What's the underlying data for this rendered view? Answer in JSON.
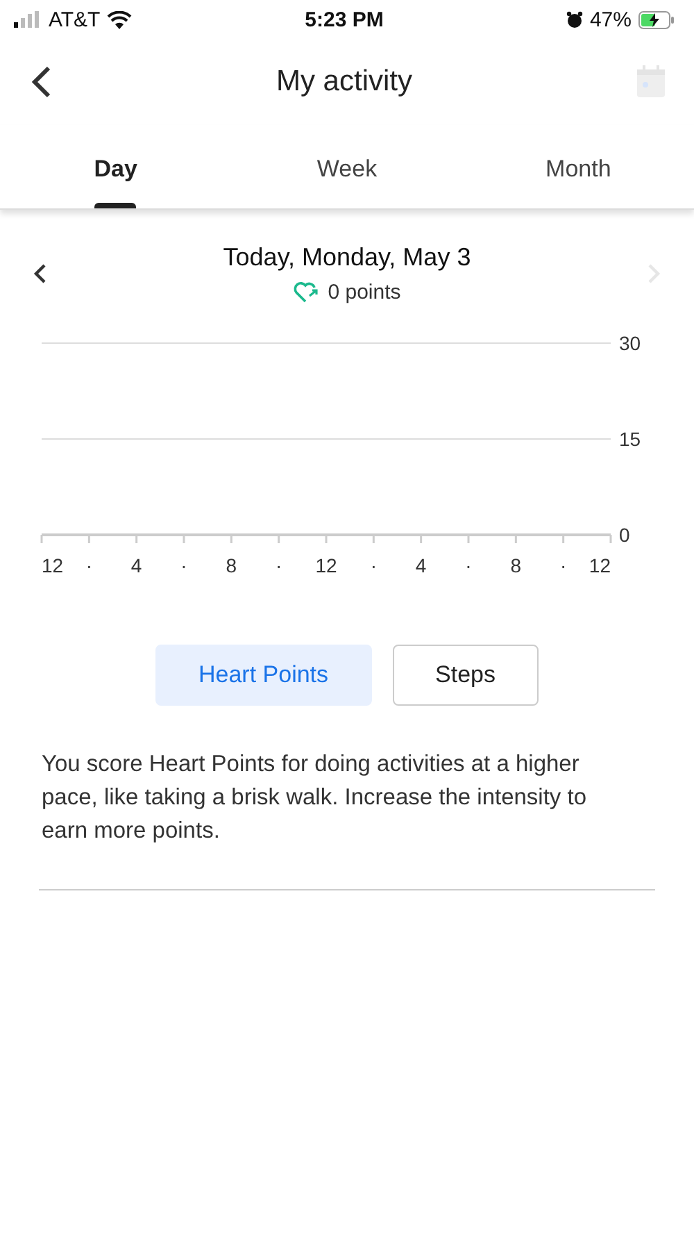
{
  "status_bar": {
    "carrier": "AT&T",
    "time": "5:23 PM",
    "battery": "47%"
  },
  "header": {
    "title": "My activity"
  },
  "tabs": [
    {
      "label": "Day",
      "selected": true
    },
    {
      "label": "Week",
      "selected": false
    },
    {
      "label": "Month",
      "selected": false
    }
  ],
  "day": {
    "title": "Today, Monday, May 3",
    "points": "0 points",
    "next_disabled": true
  },
  "chart": {
    "chart_data": {
      "type": "bar",
      "ylim": [
        0,
        30
      ],
      "yticks": [
        0,
        15,
        30
      ],
      "categories": [
        "12",
        "·",
        "4",
        "·",
        "8",
        "·",
        "12",
        "·",
        "4",
        "·",
        "8",
        "·",
        "12"
      ],
      "values": [
        0,
        0,
        0,
        0,
        0,
        0,
        0,
        0,
        0,
        0,
        0,
        0,
        0
      ]
    }
  },
  "metric_buttons": [
    {
      "label": "Heart Points",
      "selected": true
    },
    {
      "label": "Steps",
      "selected": false
    }
  ],
  "description": "You score Heart Points for doing activities at a higher pace, like taking a brisk walk. Increase the intensity to earn more points."
}
